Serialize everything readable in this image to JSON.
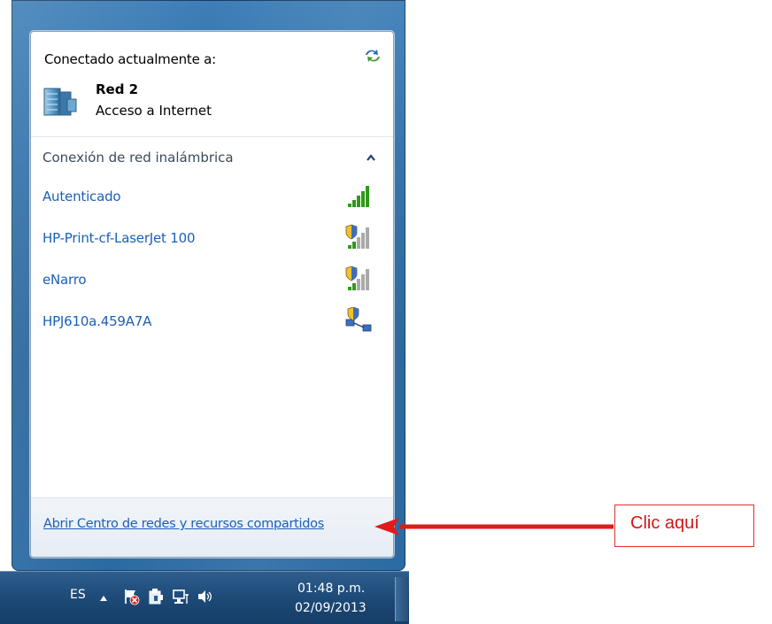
{
  "network_popup": {
    "connected_header": "Conectado actualmente a:",
    "current_network": {
      "name": "Red  2",
      "status": "Acceso a Internet"
    },
    "wireless_section": {
      "title": "Conexión de red inalámbrica",
      "networks": [
        {
          "name": "Autenticado",
          "signal": "full",
          "secured": false
        },
        {
          "name": "HP-Print-cf-LaserJet 100",
          "signal": "medium",
          "secured": true
        },
        {
          "name": "eNarro",
          "signal": "medium",
          "secured": true
        },
        {
          "name": "HPJ610a.459A7A",
          "signal": "adhoc",
          "secured": true
        }
      ]
    },
    "footer_link": "Abrir Centro de redes y recursos compartidos"
  },
  "taskbar": {
    "language": "ES",
    "time": "01:48 p.m.",
    "date": "02/09/2013",
    "tray_icons": [
      "show-hidden-icons-arrow",
      "action-center-flag-icon",
      "device-icon",
      "network-icon",
      "volume-icon"
    ]
  },
  "annotation": {
    "label": "Clic aquí",
    "color": "#e01b1b"
  },
  "colors": {
    "link": "#1c5fb7",
    "glass": "#2f6ea8",
    "signal_green": "#2e9a1a"
  }
}
